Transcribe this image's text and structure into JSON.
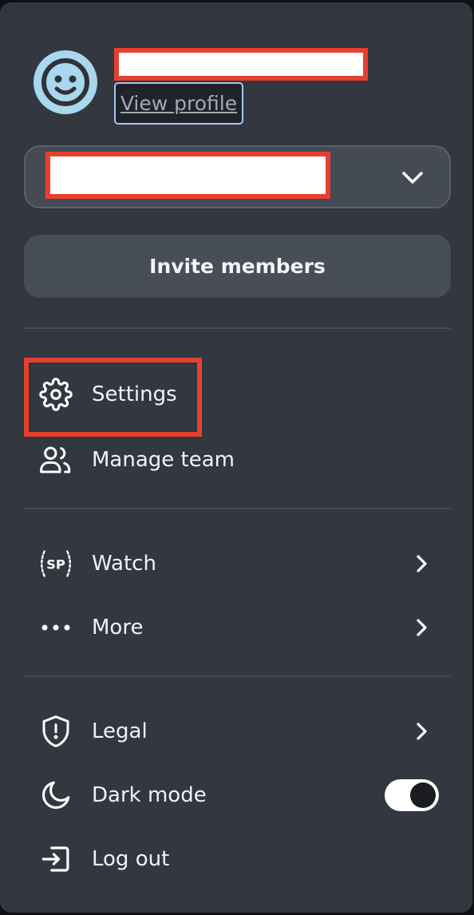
{
  "profile": {
    "view_profile_label": "View profile",
    "avatar_icon": "smiley-face-icon"
  },
  "workspace_selector": {
    "chevron_icon": "chevron-down-icon"
  },
  "invite_button_label": "Invite members",
  "menu": {
    "group1": [
      {
        "label": "Settings",
        "icon": "gear-icon"
      },
      {
        "label": "Manage team",
        "icon": "users-icon"
      }
    ],
    "group2": [
      {
        "label": "Watch",
        "icon": "sp-laurel-icon",
        "has_arrow": true
      },
      {
        "label": "More",
        "icon": "ellipsis-icon",
        "has_arrow": true
      }
    ],
    "group3": [
      {
        "label": "Legal",
        "icon": "shield-alert-icon",
        "has_arrow": true
      },
      {
        "label": "Dark mode",
        "icon": "moon-icon",
        "toggle_on": true
      },
      {
        "label": "Log out",
        "icon": "logout-icon"
      }
    ],
    "watch_badge_text": "SP"
  },
  "colors": {
    "panel_bg": "#323740",
    "accent_red": "#e8402f",
    "avatar_bg": "#a8d7ee",
    "text": "#f2f3f5"
  }
}
